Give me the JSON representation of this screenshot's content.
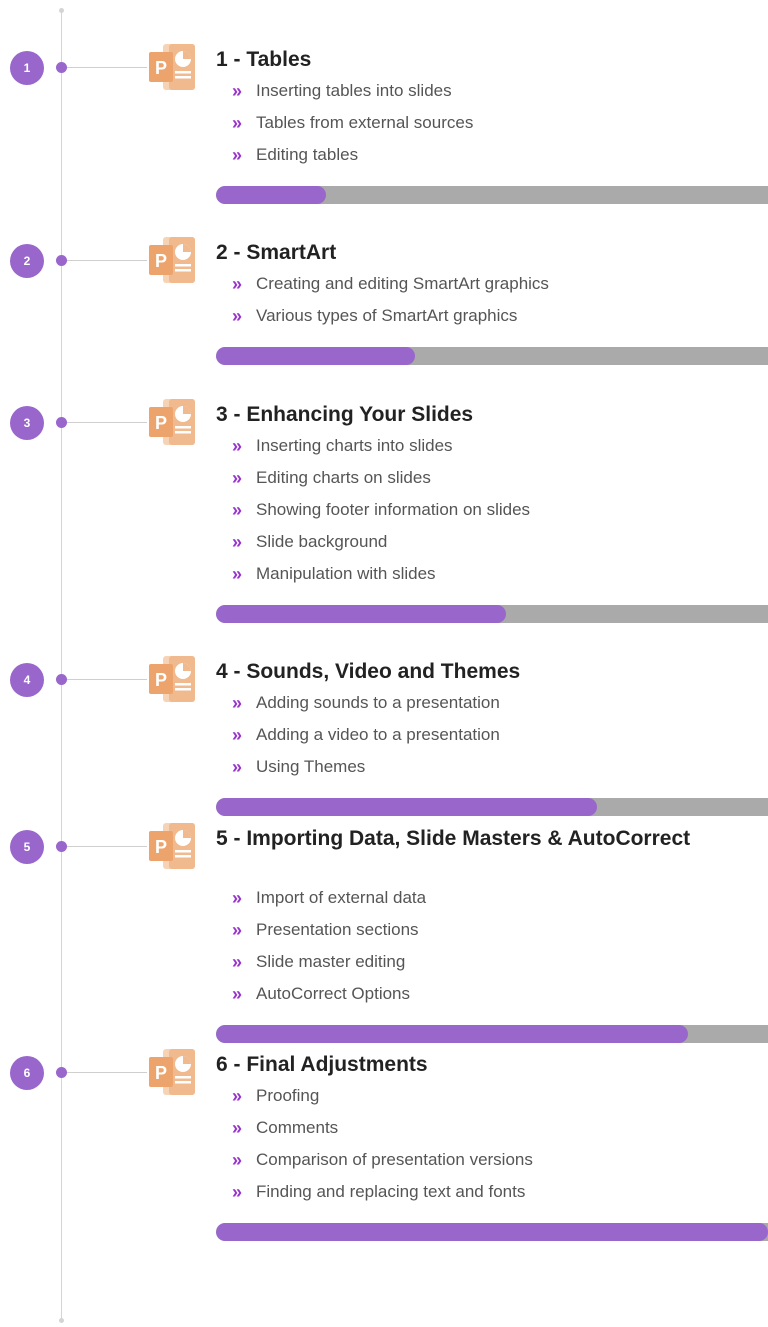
{
  "colors": {
    "accent": "#9966cc",
    "bullet": "#9933cc",
    "track": "#aaaaaa",
    "icon": "#f0b98e"
  },
  "icon_name": "powerpoint-file-icon",
  "icon_letter": "P",
  "bullet_glyph": "»",
  "modules": [
    {
      "number": "1",
      "title": "1 - Tables",
      "lessons": [
        "Inserting tables into slides",
        "Tables from external sources",
        "Editing tables"
      ],
      "progress": 0.2
    },
    {
      "number": "2",
      "title": "2 - SmartArt",
      "lessons": [
        "Creating and editing SmartArt graphics",
        "Various types of SmartArt graphics"
      ],
      "progress": 0.36
    },
    {
      "number": "3",
      "title": "3 - Enhancing Your Slides",
      "lessons": [
        "Inserting charts into slides",
        "Editing charts on slides",
        "Showing footer information on slides",
        "Slide background",
        "Manipulation with slides"
      ],
      "progress": 0.525
    },
    {
      "number": "4",
      "title": "4 - Sounds, Video and Themes",
      "lessons": [
        "Adding sounds to a presentation",
        "Adding a video to a presentation",
        "Using Themes"
      ],
      "progress": 0.69
    },
    {
      "number": "5",
      "title": "5 - Importing Data, Slide Masters & AutoCorrect",
      "lessons": [
        "Import of external data",
        "Presentation sections",
        "Slide master editing",
        "AutoCorrect Options"
      ],
      "progress": 0.855
    },
    {
      "number": "6",
      "title": "6 - Final Adjustments",
      "lessons": [
        "Proofing",
        "Comments",
        "Comparison of presentation versions",
        "Finding and replacing text and fonts"
      ],
      "progress": 1.0
    }
  ]
}
